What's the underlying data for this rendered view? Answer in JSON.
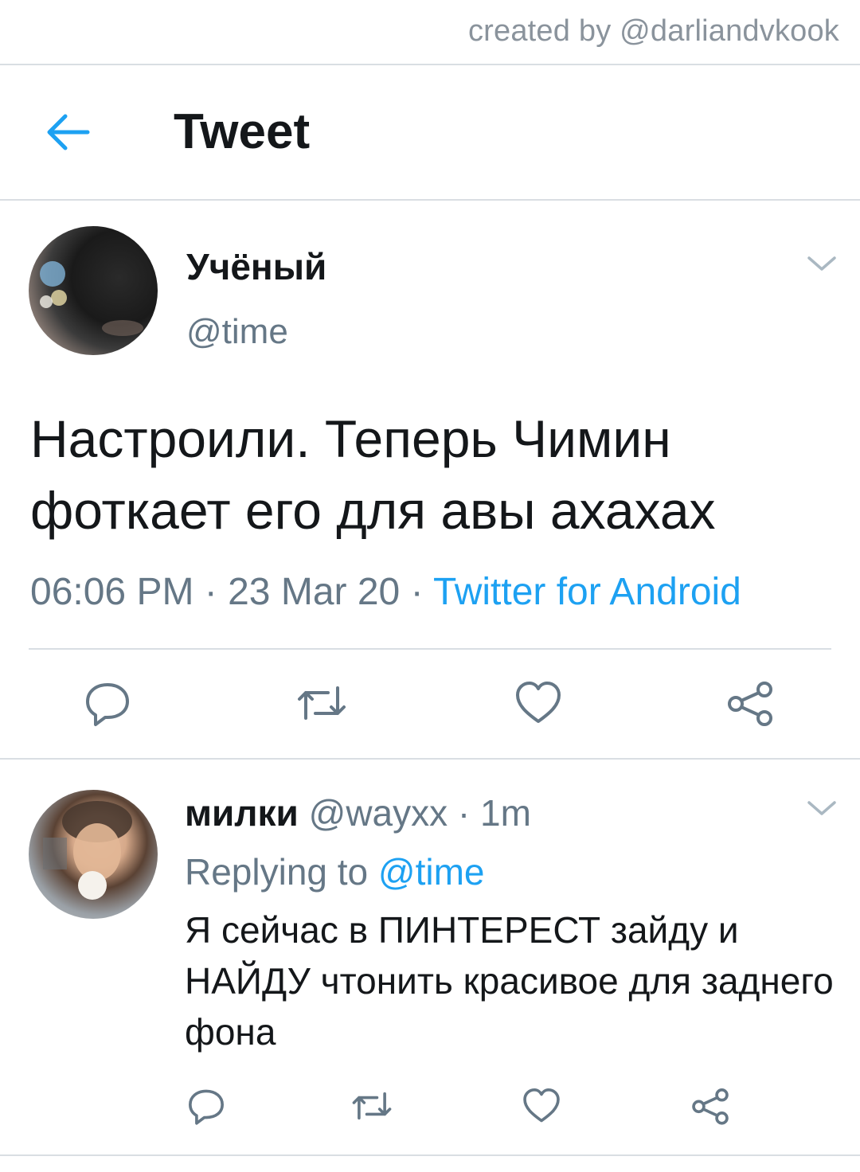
{
  "credit": "created by @darliandvkook",
  "header": {
    "title": "Tweet",
    "back_icon": "arrow-left-icon"
  },
  "tweet": {
    "display_name": "Учёный",
    "handle": "@time",
    "text": "Настроили. Теперь Чимин фоткает его для авы ахахах",
    "time": "06:06 PM",
    "sep1": " · ",
    "date": "23 Mar 20",
    "sep2": " · ",
    "source": "Twitter for Android",
    "actions": [
      "reply-icon",
      "retweet-icon",
      "like-icon",
      "share-icon"
    ]
  },
  "reply": {
    "display_name": "милки",
    "handle": "@wayxx",
    "sep": " · ",
    "time": "1m",
    "replying_label": "Replying to ",
    "replying_to": "@time",
    "text": "Я сейчас в ПИНТЕРЕСТ зайду и НАЙДУ чтонить красивое для заднего фона"
  },
  "colors": {
    "accent": "#1da1f2",
    "secondary_text": "#657786",
    "icon_gray": "#657786",
    "divider": "#d9dee3"
  }
}
